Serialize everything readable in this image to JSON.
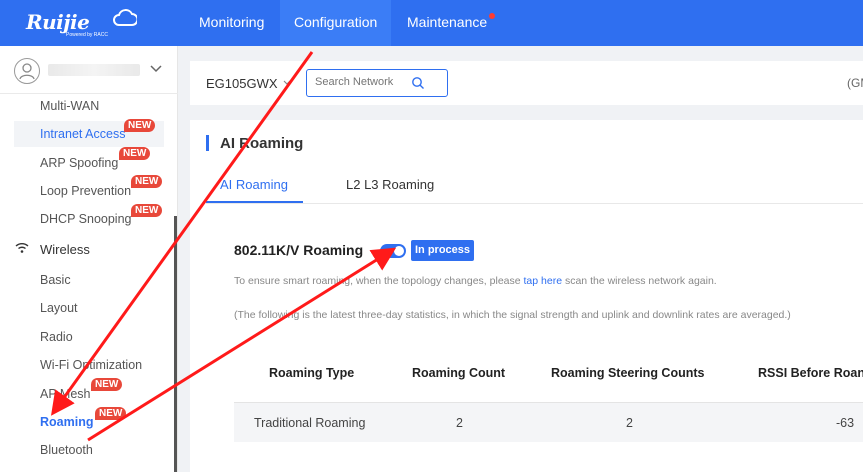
{
  "brand": {
    "logo_text": "Ruijie",
    "logo_sub": "Powered by RACC"
  },
  "top_nav": {
    "items": [
      {
        "label": "Monitoring"
      },
      {
        "label": "Configuration",
        "active": true
      },
      {
        "label": "Maintenance",
        "has_alert": true
      }
    ]
  },
  "sidebar": {
    "items": [
      {
        "label": "Multi-WAN"
      },
      {
        "label": "Intranet Access",
        "badge": "NEW",
        "active": true
      },
      {
        "label": "ARP Spoofing",
        "badge": "NEW"
      },
      {
        "label": "Loop Prevention",
        "badge": "NEW"
      },
      {
        "label": "DHCP Snooping",
        "badge": "NEW"
      }
    ],
    "section": {
      "label": "Wireless",
      "icon": "wifi-icon"
    },
    "wireless_items": [
      {
        "label": "Basic"
      },
      {
        "label": "Layout"
      },
      {
        "label": "Radio"
      },
      {
        "label": "Wi-Fi Optimization"
      },
      {
        "label": "AP Mesh",
        "badge": "NEW"
      },
      {
        "label": "Roaming",
        "badge": "NEW",
        "active": true
      },
      {
        "label": "Bluetooth"
      }
    ]
  },
  "toolbar": {
    "device": "EG105GWX",
    "search_placeholder": "Search Network",
    "gmt": "(GM"
  },
  "panel": {
    "title": "AI Roaming",
    "tabs": [
      {
        "label": "AI Roaming",
        "active": true
      },
      {
        "label": "L2 L3 Roaming"
      }
    ],
    "feature": {
      "title": "802.11K/V Roaming",
      "toggle_on": true,
      "status": "In process"
    },
    "hint_prefix": "To ensure smart roaming, when the topology changes, please",
    "hint_link": "tap here",
    "hint_suffix": "scan the wireless network again.",
    "note": "(The following is the latest three-day statistics, in which the signal strength and uplink and downlink rates are averaged.)",
    "table": {
      "headers": [
        "Roaming Type",
        "Roaming Count",
        "Roaming Steering Counts",
        "RSSI Before Roan"
      ],
      "rows": [
        [
          "Traditional Roaming",
          "2",
          "2",
          "-63"
        ]
      ]
    }
  },
  "colors": {
    "accent": "#2f6ff0",
    "badge": "#e8483a",
    "arrow": "#ff1a1a"
  }
}
